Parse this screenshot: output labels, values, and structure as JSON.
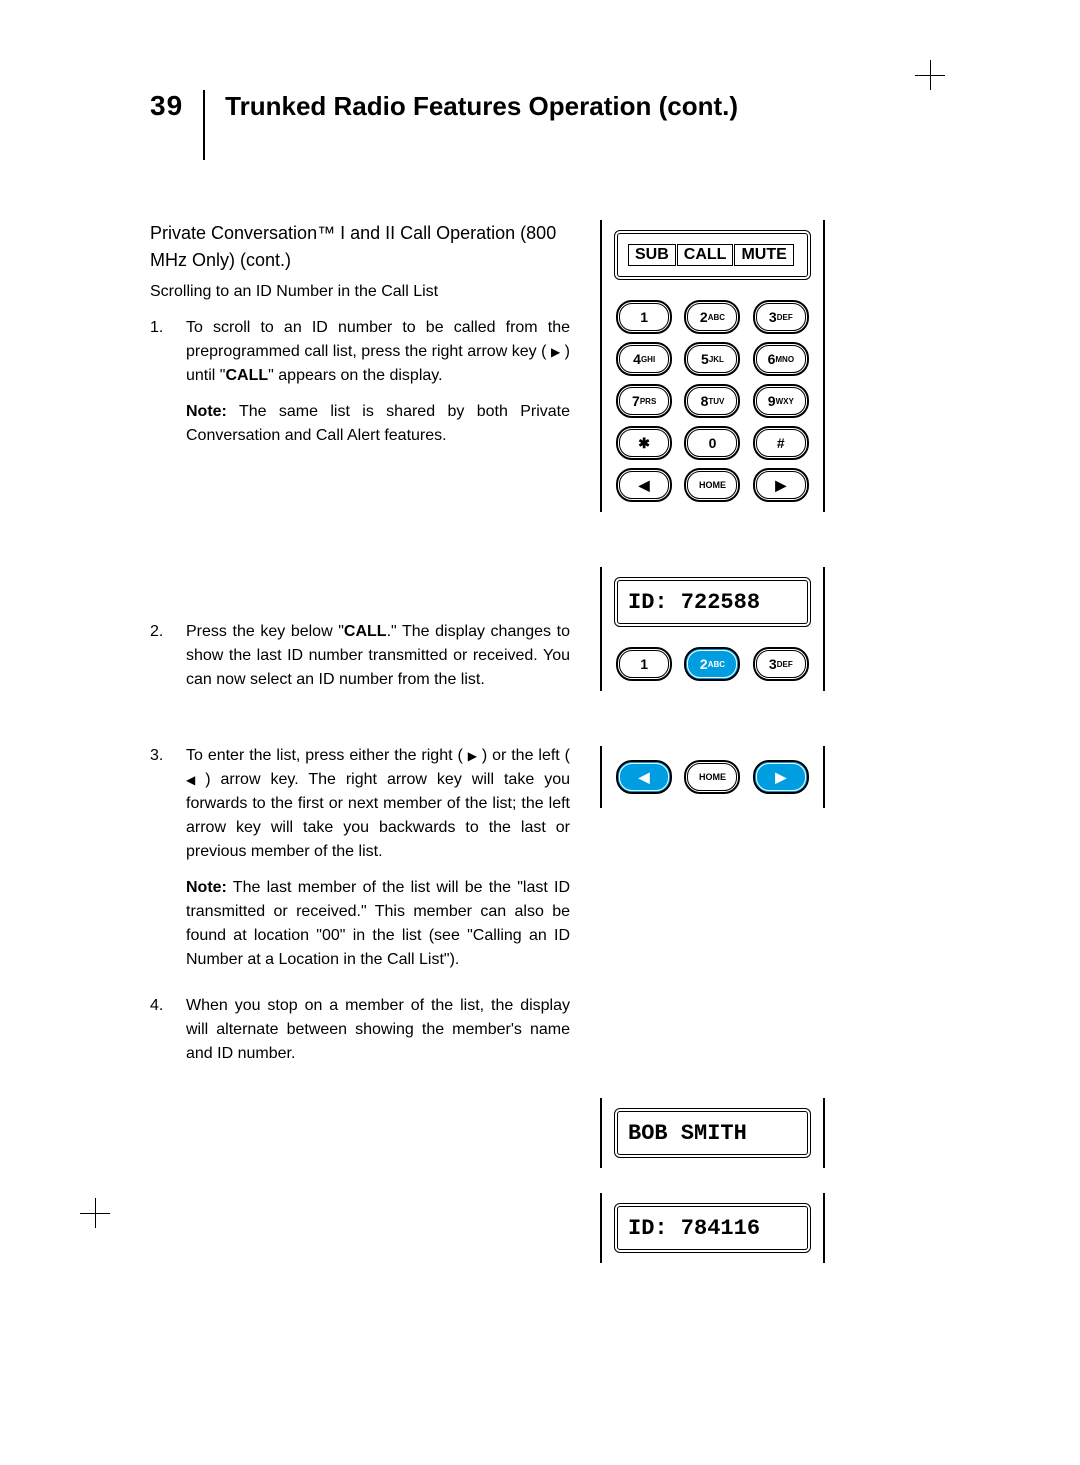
{
  "page_number": "39",
  "page_title": "Trunked Radio Features Operation (cont.)",
  "subsection_title": "Private Conversation™ I and II Call Operation (800 MHz Only) (cont.)",
  "subsection_sub": "Scrolling to an ID Number in the Call List",
  "steps": {
    "s1": {
      "num": "1.",
      "p1a": "To scroll to an ID number to be called from the preprogrammed call list, press the right arrow key ( ",
      "p1b": " ) until \"",
      "p1_bold": "CALL",
      "p1c": "\" appears on the display.",
      "note_label": "Note:",
      "note_text": " The same list is shared by both Private Conversation and Call Alert features."
    },
    "s2": {
      "num": "2.",
      "p1a": "Press the key below \"",
      "p1_bold": "CALL",
      "p1b": ".\" The display changes to show the last ID number transmitted or received. You can now select an ID number from the list."
    },
    "s3": {
      "num": "3.",
      "p1a": "To enter the list, press either the right ( ",
      "p1b": " ) or the left ( ",
      "p1c": " ) arrow key. The right arrow key will take you forwards to the first or next member of the list; the left arrow key will take you backwards to the last or previous member of the list.",
      "note_label": "Note:",
      "note_text": " The last member of the list will be the \"last ID transmitted or received.\" This member can also be found at location \"00\" in the list (see \"Calling an ID Number at a Location in the Call List\")."
    },
    "s4": {
      "num": "4.",
      "p1": "When you stop on a member of the list, the display will alternate between showing the member's name and ID number."
    }
  },
  "figures": {
    "f1": {
      "lcd_segments": [
        "SUB",
        "CALL",
        "MUTE"
      ],
      "keys": [
        {
          "label": "1"
        },
        {
          "label": "2",
          "sub": "ABC"
        },
        {
          "label": "3",
          "sub": "DEF"
        },
        {
          "label": "4",
          "sub": "GHI"
        },
        {
          "label": "5",
          "sub": "JKL"
        },
        {
          "label": "6",
          "sub": "MNO"
        },
        {
          "label": "7",
          "sub": "PRS"
        },
        {
          "label": "8",
          "sub": "TUV"
        },
        {
          "label": "9",
          "sub": "WXY"
        },
        {
          "label": "✱"
        },
        {
          "label": "0"
        },
        {
          "label": "#"
        },
        {
          "label": "◀"
        },
        {
          "label": "HOME"
        },
        {
          "label": "▶"
        }
      ]
    },
    "f2": {
      "lcd_text": "ID: 722588",
      "keys": [
        {
          "label": "1"
        },
        {
          "label": "2",
          "sub": "ABC",
          "hl": true
        },
        {
          "label": "3",
          "sub": "DEF"
        }
      ]
    },
    "f3": {
      "keys": [
        {
          "label": "◀",
          "hl": true
        },
        {
          "label": "HOME"
        },
        {
          "label": "▶",
          "hl": true
        }
      ]
    },
    "f4": {
      "lcd_text": "BOB SMITH"
    },
    "f5": {
      "lcd_text": "ID: 784116"
    }
  }
}
